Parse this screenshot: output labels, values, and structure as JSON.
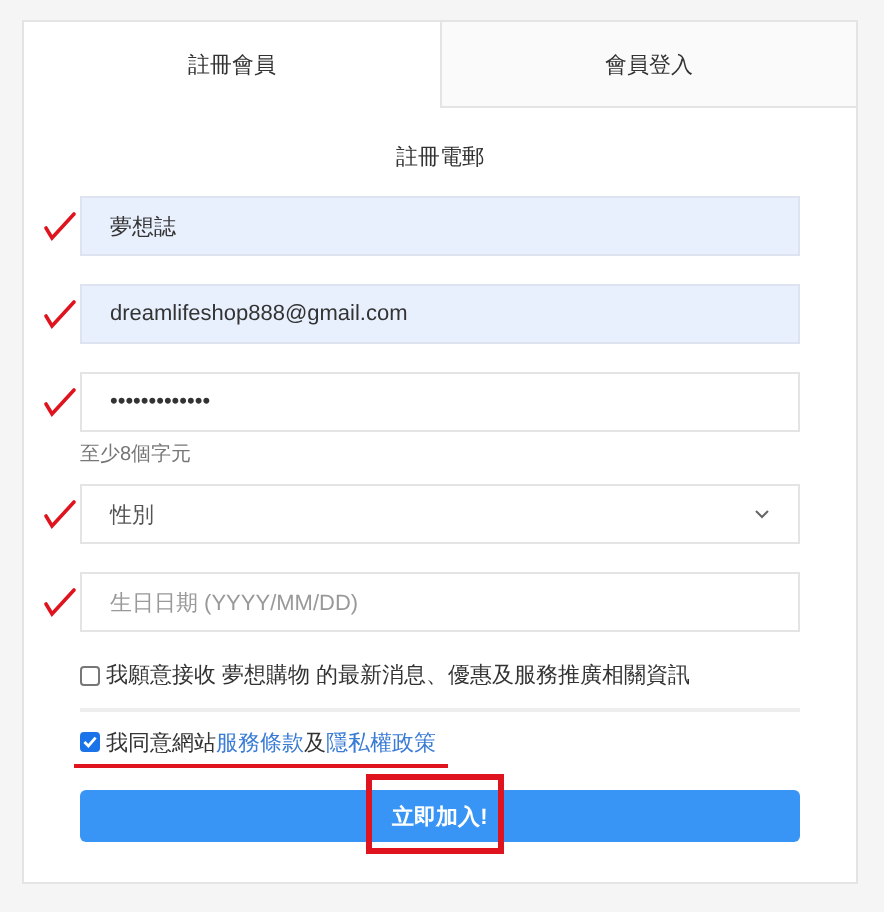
{
  "tabs": [
    {
      "label": "註冊會員",
      "selected": true
    },
    {
      "label": "會員登入",
      "selected": false
    }
  ],
  "heading": "註冊電郵",
  "fields": [
    {
      "kind": "text",
      "value": "夢想誌",
      "autofilled": true,
      "checkmark": true
    },
    {
      "kind": "text",
      "value": "dreamlifeshop888@gmail.com",
      "autofilled": true,
      "checkmark": true
    },
    {
      "kind": "password",
      "value": "•••••••••••••",
      "autofilled": false,
      "checkmark": true,
      "hint": "至少8個字元"
    },
    {
      "kind": "select",
      "value": "性別",
      "autofilled": false,
      "checkmark": true
    },
    {
      "kind": "text",
      "placeholder": "生日日期 (YYYY/MM/DD)",
      "autofilled": false,
      "checkmark": true
    }
  ],
  "newsletter": {
    "label": "我願意接收 夢想購物 的最新消息、優惠及服務推廣相關資訊",
    "checked": false
  },
  "terms": {
    "before": "我同意網站",
    "link_1": "服務條款",
    "middle": "及",
    "link_2": "隱私權政策",
    "checked": true,
    "underlined": true
  },
  "submit": {
    "label": "立即加入!",
    "boxed": true
  }
}
